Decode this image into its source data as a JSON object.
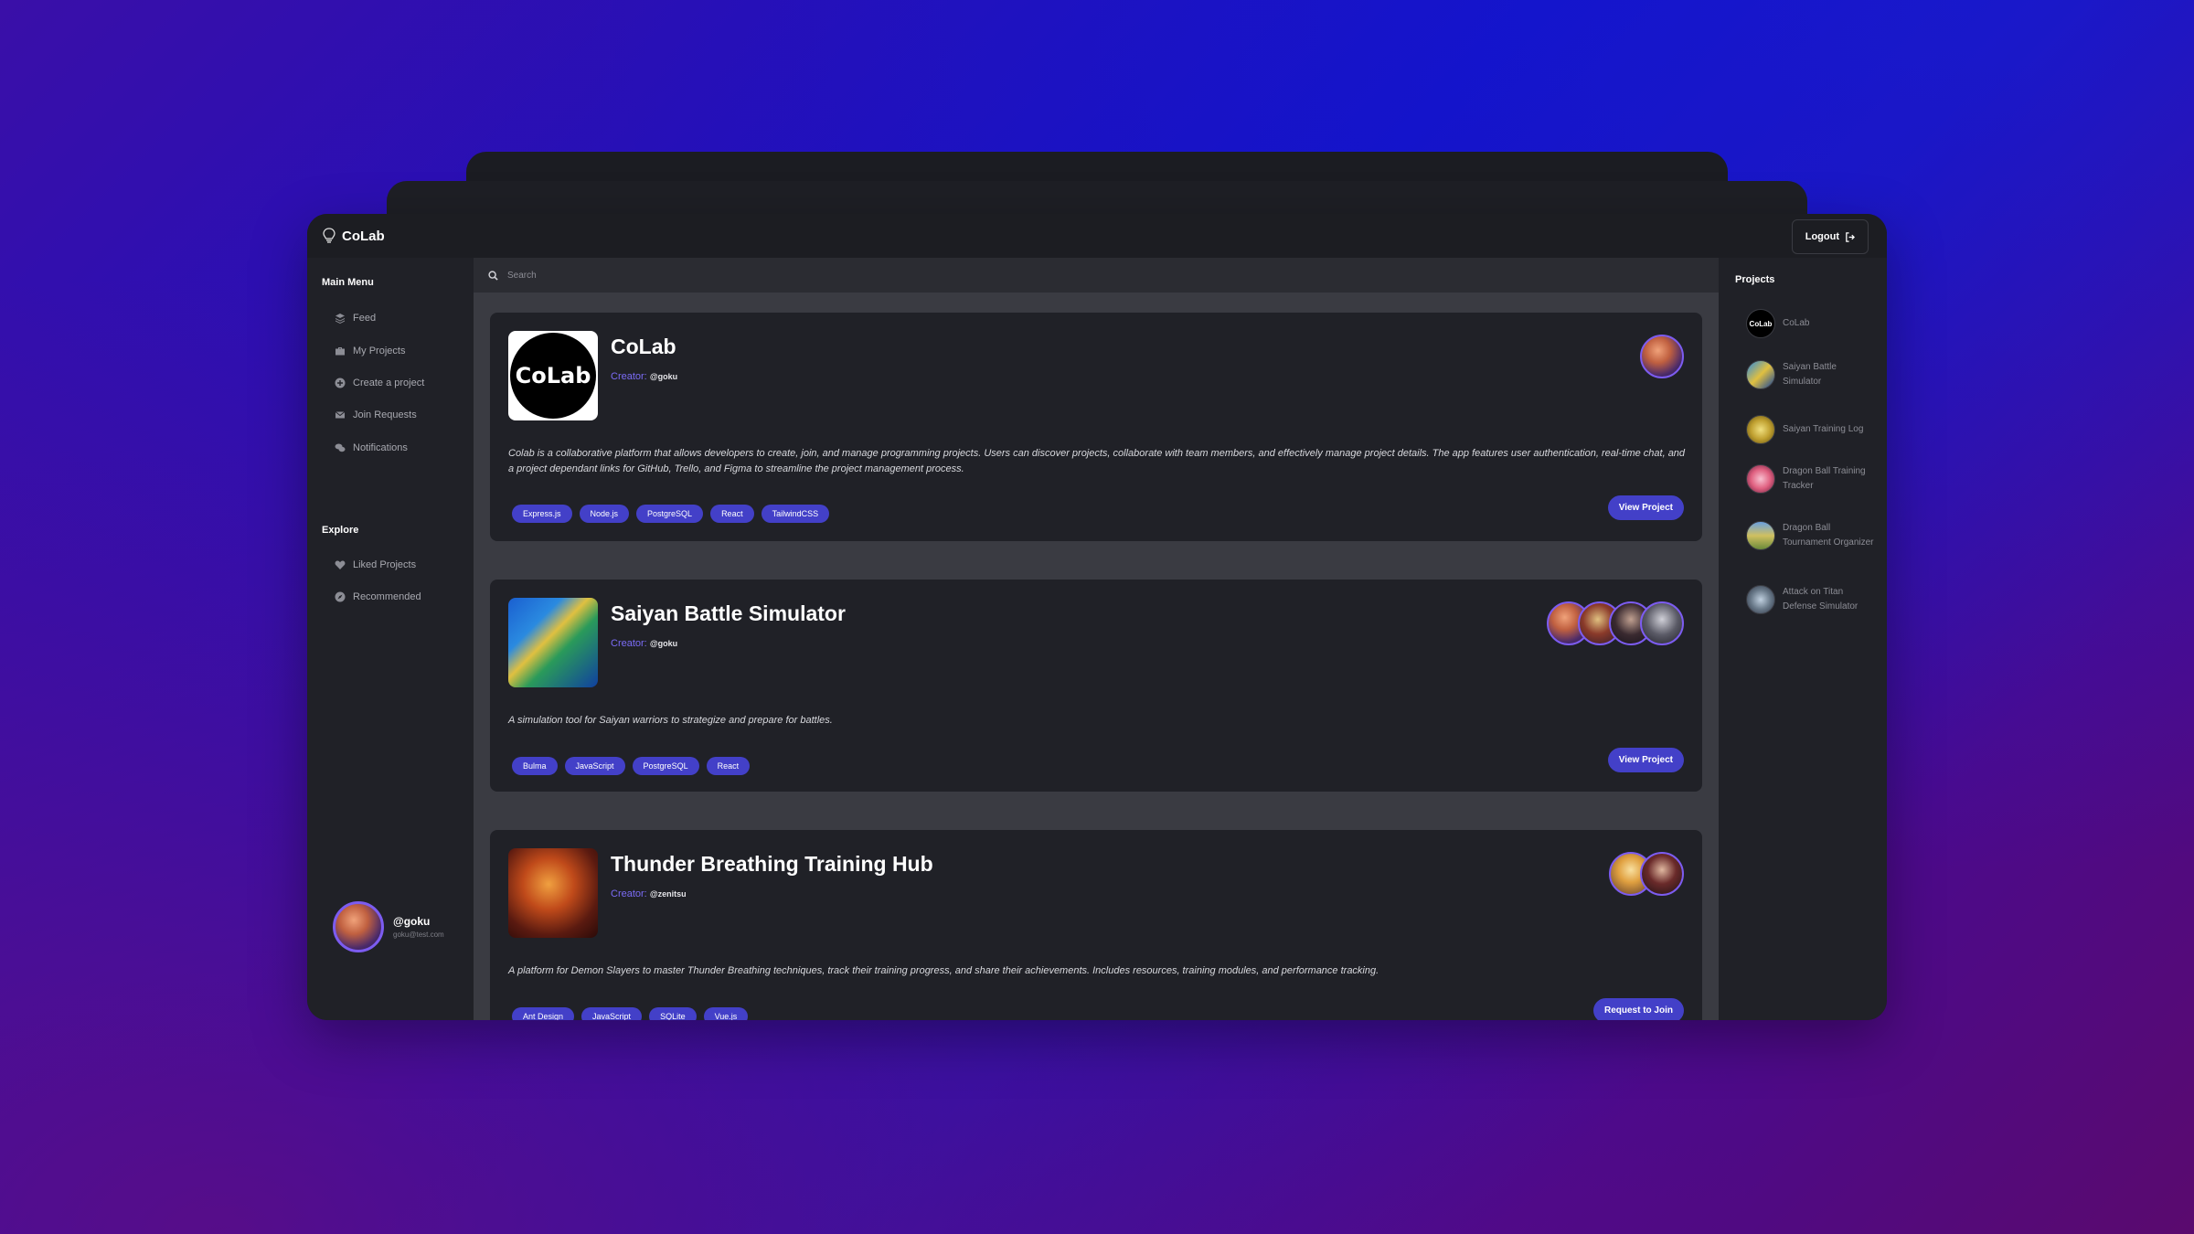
{
  "app": {
    "name": "CoLab"
  },
  "topbar": {
    "logout_label": "Logout"
  },
  "sidebar": {
    "main_menu_title": "Main Menu",
    "main_items": [
      {
        "label": "Feed",
        "icon": "layers-icon"
      },
      {
        "label": "My Projects",
        "icon": "briefcase-icon"
      },
      {
        "label": "Create a project",
        "icon": "plus-circle-icon"
      },
      {
        "label": "Join Requests",
        "icon": "envelope-icon"
      },
      {
        "label": "Notifications",
        "icon": "comments-icon"
      }
    ],
    "explore_title": "Explore",
    "explore_items": [
      {
        "label": "Liked Projects",
        "icon": "heart-icon"
      },
      {
        "label": "Recommended",
        "icon": "compass-icon"
      }
    ],
    "user": {
      "handle": "@goku",
      "email": "goku@test.com"
    }
  },
  "search": {
    "placeholder": "Search"
  },
  "projects": [
    {
      "title": "CoLab",
      "thumb_text": "CoLab",
      "creator_label": "Creator:",
      "creator": "@goku",
      "description": "Colab is a collaborative platform that allows developers to create, join, and manage programming projects. Users can discover projects, collaborate with team members, and effectively manage project details. The app features user authentication, real-time chat, and a project dependant links for GitHub, Trello, and Figma to streamline the project management process.",
      "tags": [
        "Express.js",
        "Node.js",
        "PostgreSQL",
        "React",
        "TailwindCSS"
      ],
      "action": "View Project"
    },
    {
      "title": "Saiyan Battle Simulator",
      "creator_label": "Creator:",
      "creator": "@goku",
      "description": "A simulation tool for Saiyan warriors to strategize and prepare for battles.",
      "tags": [
        "Bulma",
        "JavaScript",
        "PostgreSQL",
        "React"
      ],
      "action": "View Project"
    },
    {
      "title": "Thunder Breathing Training Hub",
      "creator_label": "Creator:",
      "creator": "@zenitsu",
      "description": "A platform for Demon Slayers to master Thunder Breathing techniques, track their training progress, and share their achievements. Includes resources, training modules, and performance tracking.",
      "tags": [
        "Ant Design",
        "JavaScript",
        "SQLite",
        "Vue.js"
      ],
      "action": "Request to Join"
    }
  ],
  "right_panel": {
    "title": "Projects",
    "items": [
      {
        "label": "CoLab",
        "avatar_text": "CoLab"
      },
      {
        "label": "Saiyan Battle Simulator"
      },
      {
        "label": "Saiyan Training Log"
      },
      {
        "label": "Dragon Ball Training Tracker"
      },
      {
        "label": "Dragon Ball Tournament Organizer"
      },
      {
        "label": "Attack on Titan Defense Simulator"
      }
    ]
  },
  "colors": {
    "accent": "#4340c8",
    "creator": "#7b6cf6",
    "panel": "#202127"
  }
}
